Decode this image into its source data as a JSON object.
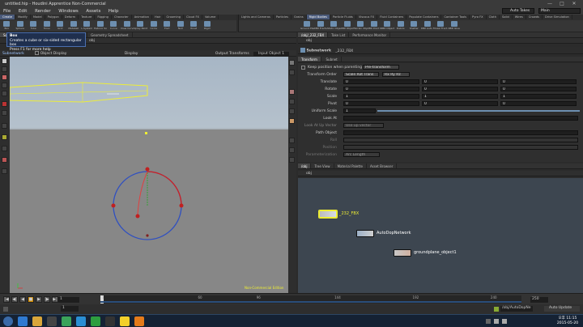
{
  "window_title": "untitled.hip - Houdini Apprentice Non-Commercial",
  "window_buttons": [
    "—",
    "□",
    "✕"
  ],
  "menu": [
    "File",
    "Edit",
    "Render",
    "Windows",
    "Assets",
    "Help"
  ],
  "desktop_selector": "Auto Takes",
  "desktop_name": "Main",
  "shelf_left": {
    "tabs": [
      "Create",
      "Modify",
      "Model",
      "Polygon",
      "Deform",
      "Texture",
      "Rigging",
      "Character",
      "Animation",
      "Hair",
      "Grooming",
      "Cloud FX",
      "Volume"
    ],
    "tools": [
      "Box",
      "Sphere",
      "Tube",
      "Torus",
      "Grid",
      "Metaball",
      "L-System",
      "Platonic Sol.",
      "Curve",
      "Draw Curve",
      "Spray Paint",
      "Circle",
      "Font",
      "Null",
      "Rivet",
      "Rigid"
    ]
  },
  "shelf_right": {
    "tabs": [
      "Lights and Cameras",
      "Particles",
      "Grains",
      "Rigid Bodies",
      "Particle Fluids",
      "Viscous FX",
      "Fluid Containers",
      "Populate Containers",
      "Container Tools",
      "Pyro FX",
      "Cloth",
      "Solid",
      "Wires",
      "Crowds",
      "Drive Simulation"
    ],
    "tools": [
      "Ground Plane",
      "RBD Fracture",
      "Static Object",
      "RBD Object",
      "Terrain Object",
      "RBD Point Obj.",
      "RBD Objects",
      "Debris",
      "Shatter",
      "RBD Auto Fr.",
      "Voxel Fract.",
      "RBD Glue",
      "RBD Pin",
      "RBD Cone T.",
      "RBD Hinge",
      "RBD Spring"
    ]
  },
  "tooltip": {
    "title": "Box",
    "line1": "Creates a cube or six-sided rectangular box",
    "line2": "Press F1 for more help"
  },
  "viewport": {
    "tabs": [
      "Scene View",
      "Network View",
      "Motion FX View",
      "Geometry Spreadsheet"
    ],
    "path": "obj",
    "toolbar_label": "Subnetwork",
    "object_display": "Object Display",
    "display_label": "Display",
    "output_transforms": "Output Transforms",
    "input_object": "Input Object 1",
    "watermark": "Non-Commercial Edition"
  },
  "params": {
    "tabs": [
      "/obj/_232_FBX",
      "Take List",
      "Performance Monitor"
    ],
    "path": "obj",
    "node_type": "Subnetwork",
    "node_name": "_232_FBX",
    "subtabs": [
      "Transform",
      "Subnet"
    ],
    "keep_position": "Keep position when parenting",
    "keep_value": "Pre-transform",
    "transform_order_label": "Transform Order",
    "transform_order": "Scale Rot Trans",
    "rotate_order": "Rx Ry Rz",
    "rows": [
      {
        "label": "Translate",
        "values": [
          "0",
          "0",
          "0"
        ]
      },
      {
        "label": "Rotate",
        "values": [
          "0",
          "0",
          "0"
        ]
      },
      {
        "label": "Scale",
        "values": [
          "1",
          "1",
          "1"
        ]
      },
      {
        "label": "Pivot",
        "values": [
          "0",
          "0",
          "0"
        ]
      }
    ],
    "uniform_label": "Uniform Scale",
    "uniform_value": "1",
    "lookat_label": "Look At",
    "lookup_label": "Look At Up Vector",
    "lookup_value": "Use up vector",
    "pathobj_label": "Path Object",
    "roll_label": "Roll",
    "position_label": "Position",
    "param_label": "Parameterization",
    "param_value": "Arc Length"
  },
  "network": {
    "tabs": [
      "/obj",
      "Tree View",
      "Material Palette",
      "Asset Browser"
    ],
    "path": "obj",
    "nodes": [
      "_232_FBX",
      "AutoDopNetwork",
      "groundplane_object1"
    ]
  },
  "timeline": {
    "start": "1",
    "current": "1",
    "end": "250",
    "ticks": [
      "1",
      "60",
      "96",
      "144",
      "192",
      "240"
    ]
  },
  "status": {
    "path": "/obj/AutoDopNe",
    "auto_update": "Auto Update"
  },
  "taskbar": {
    "time": "오후 11:15",
    "date": "2015-05-20"
  }
}
